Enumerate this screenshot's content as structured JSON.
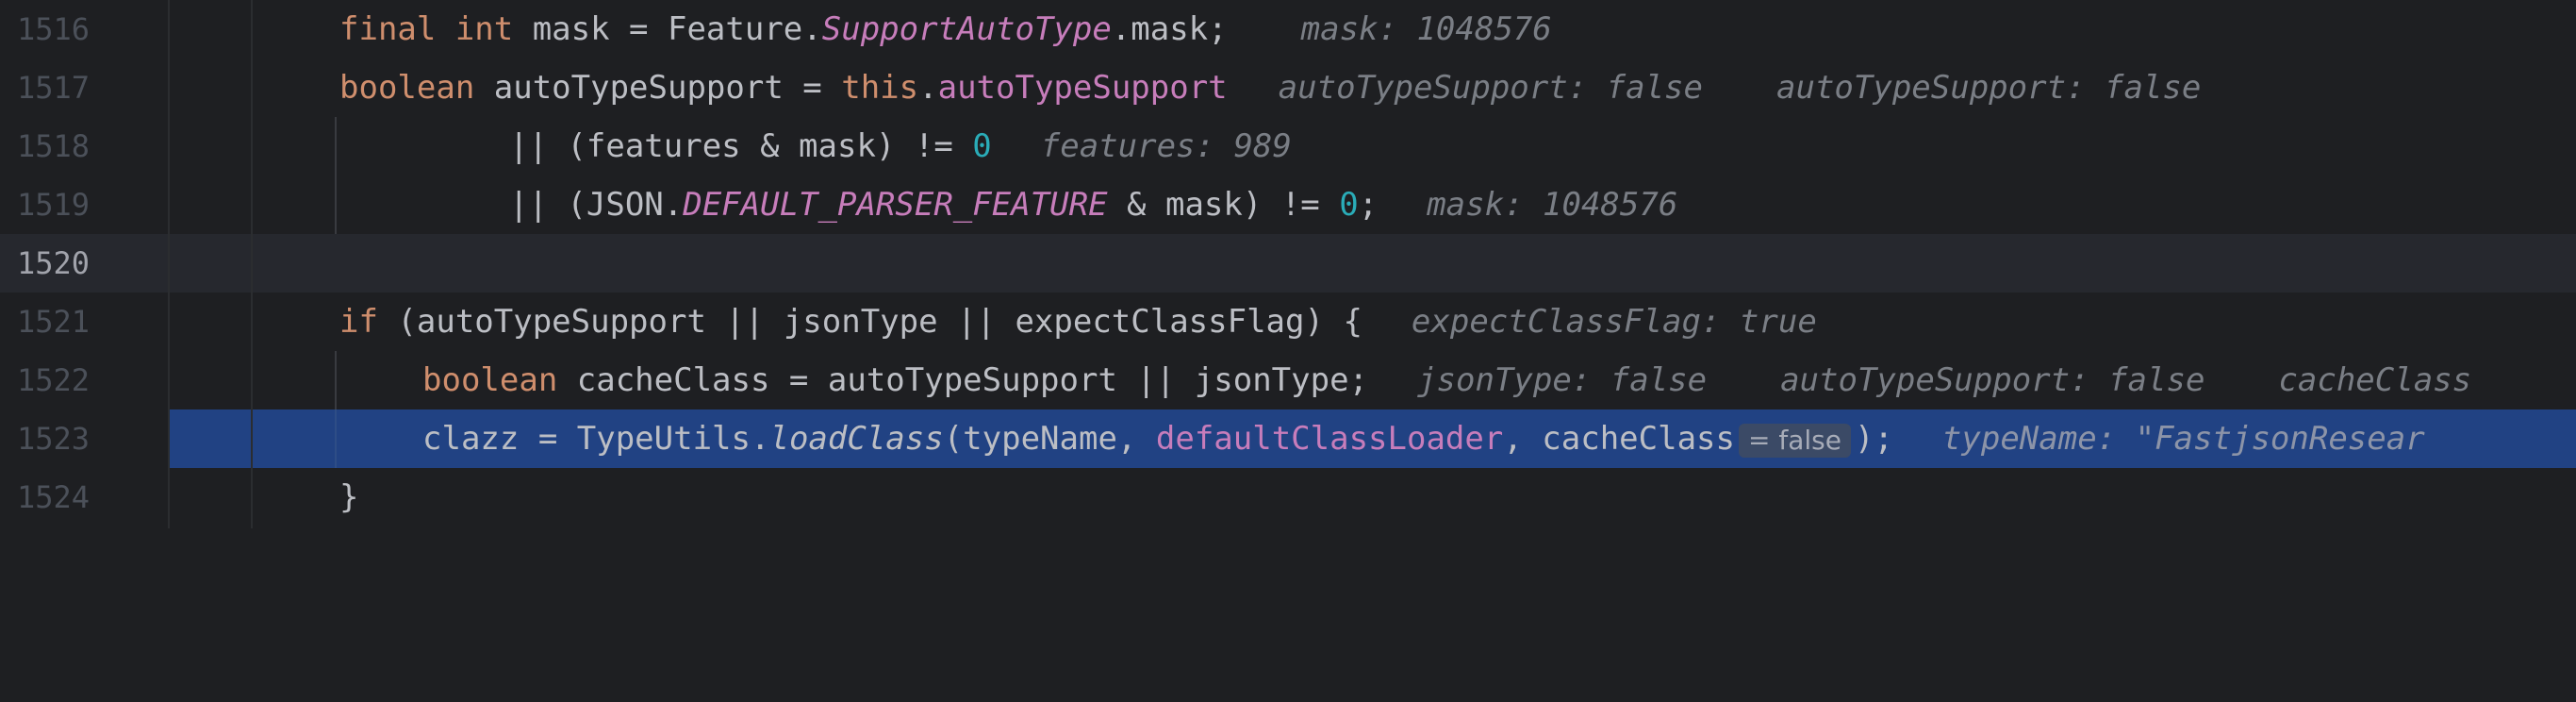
{
  "lines": [
    {
      "num": "1516"
    },
    {
      "num": "1517"
    },
    {
      "num": "1518"
    },
    {
      "num": "1519"
    },
    {
      "num": "1520"
    },
    {
      "num": "1521"
    },
    {
      "num": "1522"
    },
    {
      "num": "1523"
    },
    {
      "num": "1524"
    }
  ],
  "code": {
    "l1516": {
      "kw1": "final int",
      "t1": " mask = Feature.",
      "sf": "SupportAutoType",
      "t2": ".mask;",
      "hint": "mask: 1048576"
    },
    "l1517": {
      "kw1": "boolean",
      "t1": " autoTypeSupport = ",
      "kw2": "this",
      "t2": ".",
      "f": "autoTypeSupport",
      "hint1": "autoTypeSupport: false",
      "hint2": "autoTypeSupport: false"
    },
    "l1518": {
      "t1": "|| (features & mask) != ",
      "n": "0",
      "hint": "features: 989"
    },
    "l1519": {
      "t1": "|| (JSON.",
      "sf": "DEFAULT_PARSER_FEATURE",
      "t2": " & mask) != ",
      "n": "0",
      "t3": ";",
      "hint": "mask: 1048576"
    },
    "l1521": {
      "kw1": "if",
      "t1": " (autoTypeSupport || jsonType || expectClassFlag) {",
      "hint": "expectClassFlag: true"
    },
    "l1522": {
      "kw1": "boolean",
      "t1": " cacheClass = autoTypeSupport || jsonType;",
      "hint1": "jsonType: false",
      "hint2": "autoTypeSupport: false",
      "hint3": "cacheClass"
    },
    "l1523": {
      "t1": "clazz = TypeUtils.",
      "m": "loadClass",
      "t2": "(typeName, ",
      "f": "defaultClassLoader",
      "t3": ", cacheClass",
      "inlay": "= false",
      "t4": ");",
      "hint": "typeName: \"FastjsonResear"
    },
    "l1524": {
      "t1": "}"
    }
  }
}
